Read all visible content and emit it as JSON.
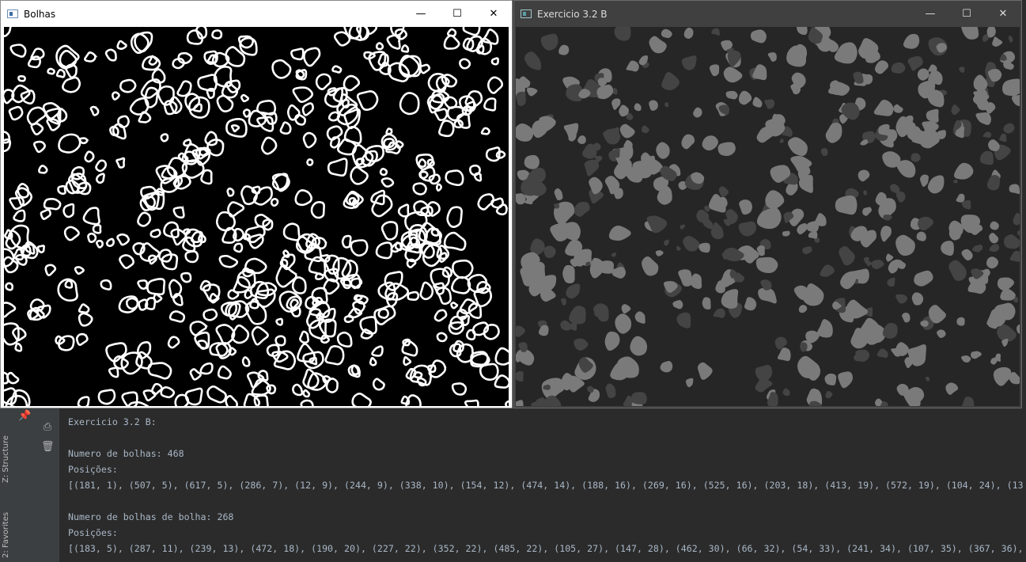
{
  "windows": {
    "bolhas": {
      "title": "Bolhas",
      "controls": {
        "minimize": "—",
        "maximize": "☐",
        "close": "✕"
      }
    },
    "exercicio": {
      "title": "Exercicio 3.2 B",
      "controls": {
        "minimize": "—",
        "maximize": "☐",
        "close": "✕"
      }
    }
  },
  "ide": {
    "side_tabs": [
      "Z: Structure",
      "2: Favorites"
    ],
    "toolbar_icons": [
      "pin-icon",
      "print-icon",
      "trash-icon"
    ],
    "console": {
      "lines": [
        "Exercicio 3.2 B:",
        "",
        "Numero de bolhas: 468",
        "Posições:",
        "[(181, 1), (507, 5), (617, 5), (286, 7), (12, 9), (244, 9), (338, 10), (154, 12), (474, 14), (188, 16), (269, 16), (525, 16), (203, 18), (413, 19), (572, 19), (104, 24), (13",
        "",
        "Numero de bolhas de bolha: 268",
        "Posições:",
        "[(183, 5), (287, 11), (239, 13), (472, 18), (190, 20), (227, 22), (352, 22), (485, 22), (105, 27), (147, 28), (462, 30), (66, 32), (54, 33), (241, 34), (107, 35), (367, 36),"
      ]
    }
  },
  "colors": {
    "outline_blob": "#ffffff",
    "filled_blob": "#7a7a7a",
    "inner_blob": "#444444",
    "console_text": "#a9b7c6"
  }
}
